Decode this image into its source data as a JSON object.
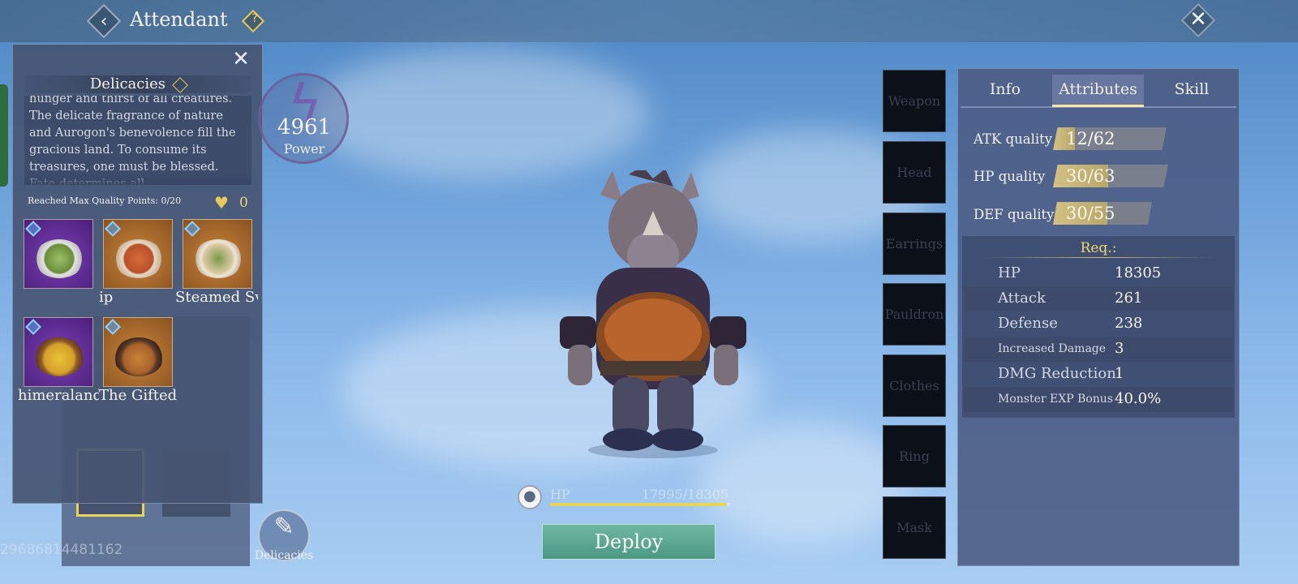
{
  "header": {
    "title": "Attendant",
    "back_icon": "back-chevron-icon",
    "help_label": "?",
    "close_glyph": "✕"
  },
  "delicacies_popup": {
    "title": "Delicacies",
    "close_glyph": "✕",
    "description": "hunger and thirst of all creatures. The delicate fragrance of nature and Aurogon's benevolence fill the gracious land. To consume its treasures, one must be blessed. Fate determines all.",
    "max_quality_label": "Reached Max Quality Points: 0/20",
    "heart_count": "0",
    "dishes": [
      {
        "name": "",
        "rarity": "purple"
      },
      {
        "name": "ip",
        "rarity": "orange"
      },
      {
        "name": "Steamed Sv",
        "rarity": "orange"
      },
      {
        "name": "himeraland",
        "rarity": "purple"
      },
      {
        "name": "The Gifted",
        "rarity": "orange"
      }
    ]
  },
  "background": {
    "id_text": "29686814481162"
  },
  "power": {
    "value": "4961",
    "label": "Power"
  },
  "delicacies_button": {
    "label": "Delicacies"
  },
  "hp_bar": {
    "label": "HP",
    "value": "17995/18305",
    "fill_fraction": 0.983
  },
  "deploy_button": {
    "label": "Deploy"
  },
  "equipment_slots": [
    "Weapon",
    "Head",
    "Earrings",
    "Pauldron",
    "Clothes",
    "Ring",
    "Mask"
  ],
  "attributes_panel": {
    "tabs": [
      {
        "label": "Info",
        "active": false
      },
      {
        "label": "Attributes",
        "active": true
      },
      {
        "label": "Skill",
        "active": false
      }
    ],
    "qualities": [
      {
        "label": "ATK quality",
        "value": "12/62",
        "current": 12,
        "max": 62
      },
      {
        "label": "HP quality",
        "value": "30/63",
        "current": 30,
        "max": 63
      },
      {
        "label": "DEF quality",
        "value": "30/55",
        "current": 30,
        "max": 55
      }
    ],
    "req_title": "Req.:",
    "req_rows": [
      {
        "name": "HP",
        "value": "18305"
      },
      {
        "name": "Attack",
        "value": "261"
      },
      {
        "name": "Defense",
        "value": "238"
      },
      {
        "name": "Increased Damage",
        "value": "3"
      },
      {
        "name": "DMG Reduction",
        "value": "1"
      },
      {
        "name": "Monster EXP Bonus",
        "value": "40.0%"
      }
    ]
  },
  "colors": {
    "accent_gold": "#e9d45a",
    "deploy_teal": "#5fa893",
    "rarity_purple": "#6a34a3",
    "rarity_orange": "#b47232"
  }
}
